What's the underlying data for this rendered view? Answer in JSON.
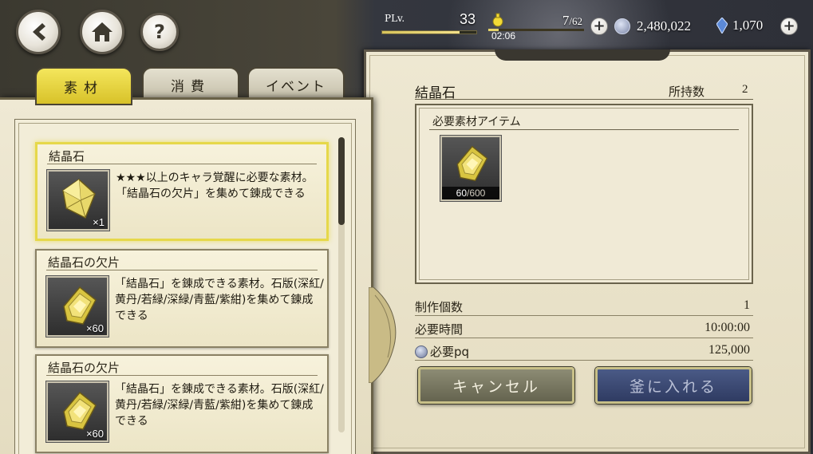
{
  "nav": {
    "back_icon": "back-arrow-icon",
    "home_icon": "home-icon",
    "help_label": "?"
  },
  "status": {
    "plv_label": "PLv.",
    "plv_value": "33",
    "plv_progress": 0.82,
    "stamina_current": "7",
    "stamina_max": "/62",
    "stamina_timer": "02:06",
    "coins": "2,480,022",
    "gems": "1,070",
    "plus": "+"
  },
  "tabs": [
    {
      "label": "素材",
      "active": true
    },
    {
      "label": "消費",
      "active": false
    },
    {
      "label": "イベント",
      "active": false
    }
  ],
  "items": [
    {
      "name": "結晶石",
      "description": "★★★以上のキャラ覚醒に必要な素材。「結晶石の欠片」を集めて錬成できる",
      "quantity": "×1",
      "icon": "crystal-stone-icon",
      "selected": true
    },
    {
      "name": "結晶石の欠片",
      "description": "「結晶石」を錬成できる素材。石版(深紅/黄丹/若緑/深緑/青藍/紫紺)を集めて錬成できる",
      "quantity": "×60",
      "icon": "crystal-fragment-icon",
      "selected": false
    },
    {
      "name": "結晶石の欠片",
      "description": "「結晶石」を錬成できる素材。石版(深紅/黄丹/若緑/深緑/青藍/紫紺)を集めて錬成できる",
      "quantity": "×60",
      "icon": "crystal-fragment-icon",
      "selected": false
    }
  ],
  "detail": {
    "title": "結晶石",
    "owned_label": "所持数",
    "owned_value": "2",
    "materials_header": "必要素材アイテム",
    "material": {
      "icon": "crystal-fragment-icon",
      "have": "60",
      "need": "/600"
    },
    "craft_count_label": "制作個数",
    "craft_count_value": "1",
    "time_label": "必要時間",
    "time_value": "10:00:00",
    "pq_label": "必要pq",
    "pq_value": "125,000",
    "cancel_label": "キャンセル",
    "craft_label": "釜に入れる"
  },
  "colors": {
    "tab_active": "#e6d84a",
    "cancel_button": "#7a7962",
    "craft_button": "#3b4a74",
    "panel_bg": "#eee8d2"
  }
}
